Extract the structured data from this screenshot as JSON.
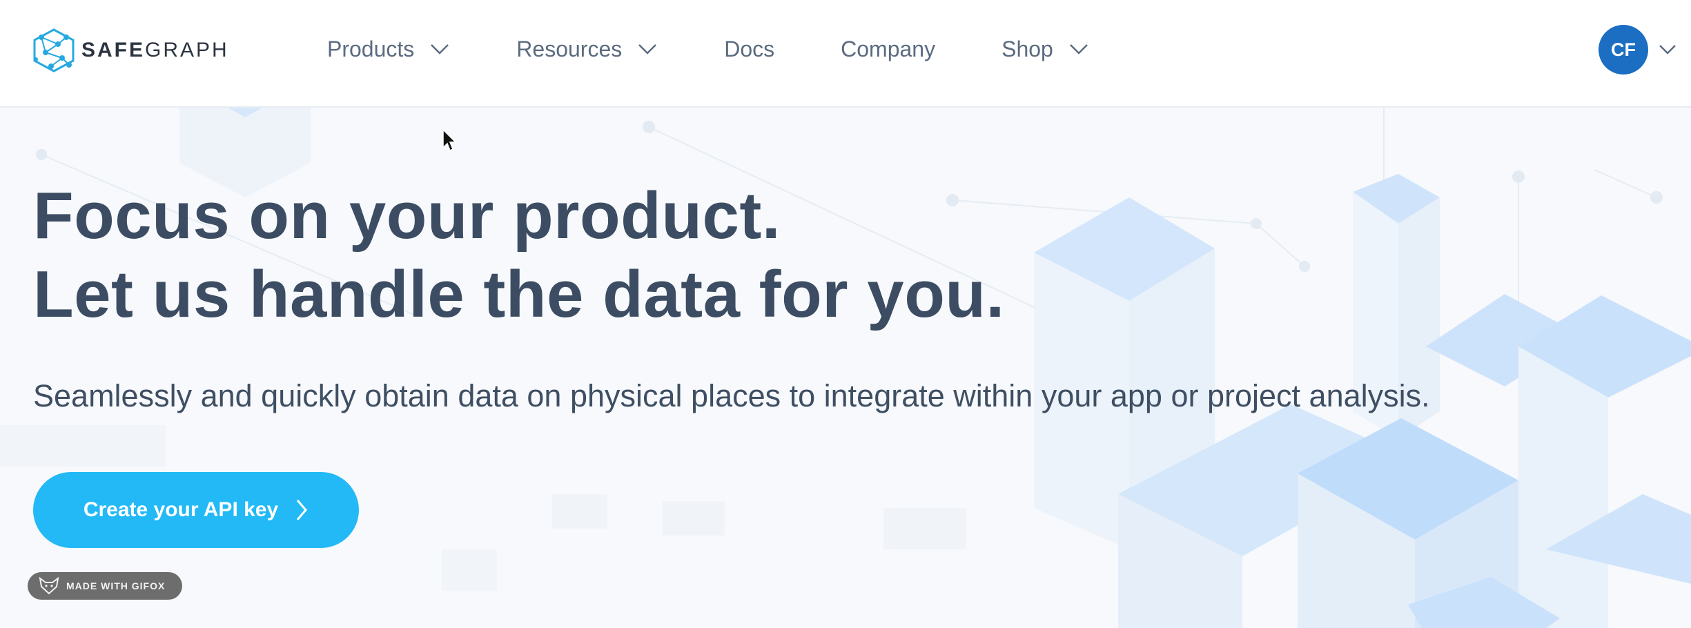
{
  "brand": {
    "name_bold": "SAFE",
    "name_light": "GRAPH"
  },
  "nav": {
    "items": [
      {
        "label": "Products",
        "has_dropdown": true
      },
      {
        "label": "Resources",
        "has_dropdown": true
      },
      {
        "label": "Docs",
        "has_dropdown": false
      },
      {
        "label": "Company",
        "has_dropdown": false
      },
      {
        "label": "Shop",
        "has_dropdown": true
      }
    ]
  },
  "user": {
    "initials": "CF"
  },
  "hero": {
    "headline_line1": "Focus on your product.",
    "headline_line2": "Let us handle the data for you.",
    "subtitle": "Seamlessly and quickly obtain data on physical places to integrate within your app or project analysis.",
    "cta_label": "Create your API key"
  },
  "watermark": {
    "label": "MADE WITH GIFOX"
  },
  "colors": {
    "accent": "#22b9f6",
    "avatar": "#1b6ec2",
    "heading": "#3c4d63",
    "nav_text": "#5b6b80",
    "cube_light": "#cfe4fb"
  }
}
